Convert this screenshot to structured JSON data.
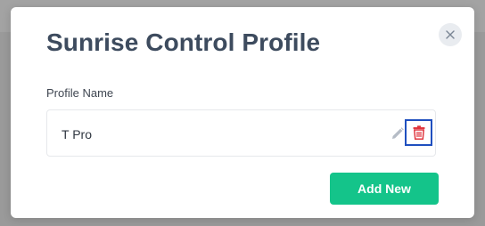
{
  "modal": {
    "title": "Sunrise Control Profile",
    "close_label": "×"
  },
  "profile": {
    "field_label": "Profile Name",
    "name": "T Pro"
  },
  "actions": {
    "add_new_label": "Add New"
  },
  "icons": {
    "close": "close-icon",
    "edit": "pencil-icon",
    "delete": "trash-icon"
  },
  "colors": {
    "title": "#3d4b5e",
    "accent_green": "#14c48a",
    "delete_red": "#e0373f",
    "focus_outline": "#1f4fbf",
    "edit_gray": "#b5bcc6"
  }
}
